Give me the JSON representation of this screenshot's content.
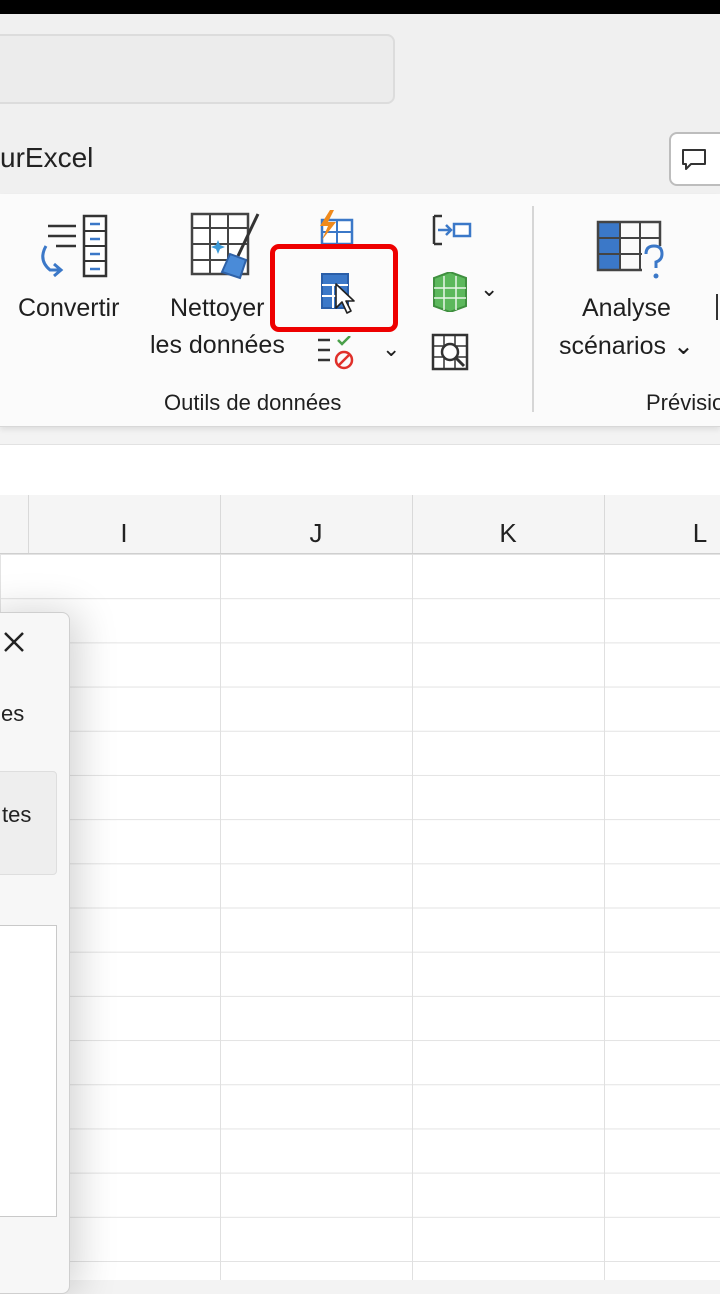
{
  "title_bar": {
    "app_title_fragment": "urExcel"
  },
  "ribbon": {
    "buttons": {
      "convertir": "Convertir",
      "nettoyer_line1": "Nettoyer",
      "nettoyer_line2": "les données",
      "analyse_line1": "Analyse",
      "analyse_line2": "scénarios ⌄"
    },
    "groups": {
      "outils": "Outils de données",
      "prevision": "Prévisio"
    },
    "dropdown_chevron": "⌄"
  },
  "columns": [
    "I",
    "J",
    "K",
    "L"
  ],
  "dialog": {
    "close_glyph": "✕",
    "text1_fragment": "es",
    "text2_fragment": "tes"
  },
  "colors": {
    "highlight": "#ee0000",
    "accent_blue": "#3b78c8",
    "green": "#4aa04a"
  }
}
